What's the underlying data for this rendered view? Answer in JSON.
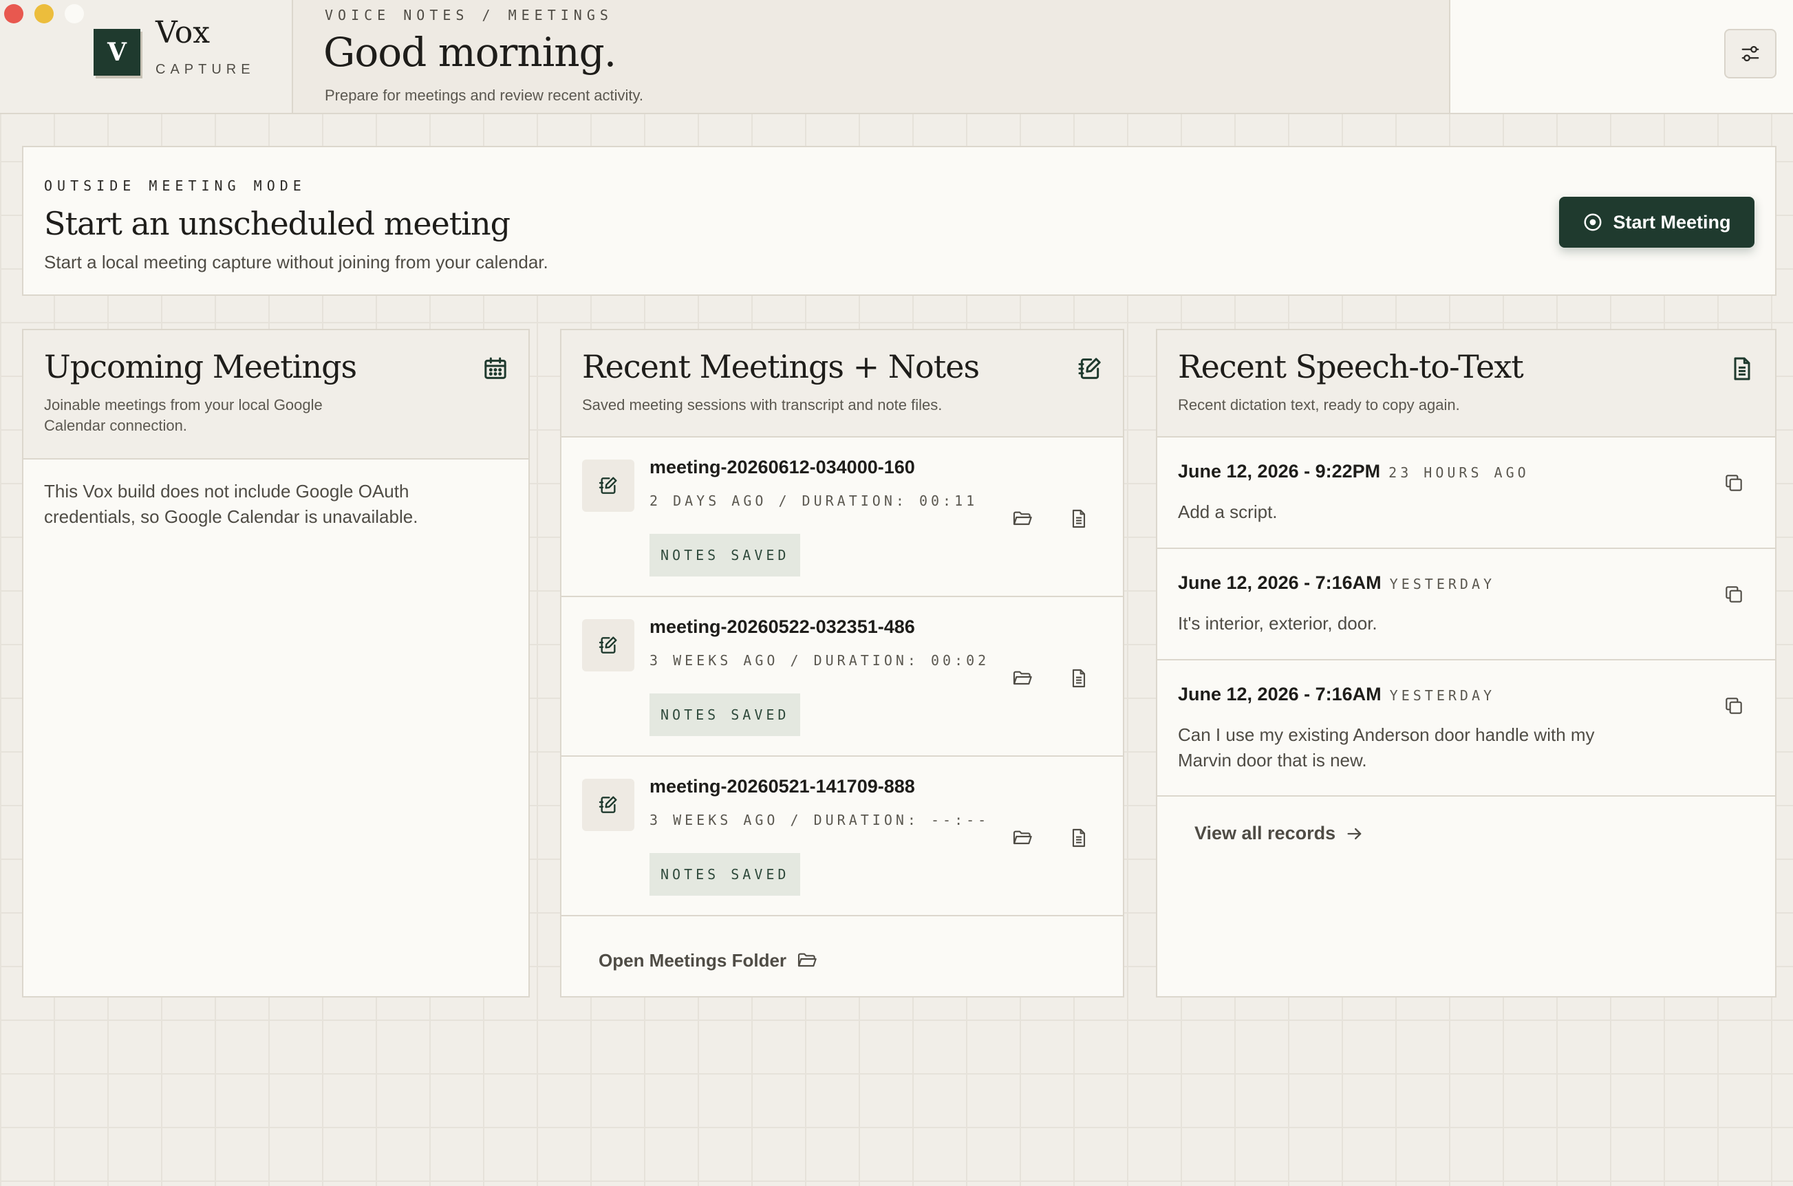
{
  "brand": {
    "logo_letter": "V",
    "name": "Vox",
    "subtitle": "CAPTURE"
  },
  "header": {
    "breadcrumb": "VOICE NOTES / MEETINGS",
    "greeting": "Good morning.",
    "subtitle": "Prepare for meetings and review recent activity."
  },
  "banner": {
    "kicker": "OUTSIDE MEETING MODE",
    "title": "Start an unscheduled meeting",
    "description": "Start a local meeting capture without joining from your calendar.",
    "button_label": "Start Meeting"
  },
  "upcoming": {
    "title": "Upcoming Meetings",
    "description": "Joinable meetings from your local Google Calendar connection.",
    "body": "This Vox build does not include Google OAuth credentials, so Google Calendar is unavailable."
  },
  "meetings": {
    "title": "Recent Meetings + Notes",
    "description": "Saved meeting sessions with transcript and note files.",
    "items": [
      {
        "name": "meeting-20260612-034000-160",
        "meta": "2 DAYS AGO / DURATION: 00:11",
        "badge": "NOTES SAVED"
      },
      {
        "name": "meeting-20260522-032351-486",
        "meta": "3 WEEKS AGO / DURATION: 00:02",
        "badge": "NOTES SAVED"
      },
      {
        "name": "meeting-20260521-141709-888",
        "meta": "3 WEEKS AGO / DURATION: --:--",
        "badge": "NOTES SAVED"
      }
    ],
    "open_folder_label": "Open Meetings Folder"
  },
  "stt": {
    "title": "Recent Speech-to-Text",
    "description": "Recent dictation text, ready to copy again.",
    "items": [
      {
        "date": "June 12, 2026 - 9:22PM",
        "relative": "23 HOURS AGO",
        "text": "Add a script."
      },
      {
        "date": "June 12, 2026 - 7:16AM",
        "relative": "YESTERDAY",
        "text": "It's interior, exterior, door."
      },
      {
        "date": "June 12, 2026 - 7:16AM",
        "relative": "YESTERDAY",
        "text": "Can I use my existing Anderson door handle with my Marvin door that is new."
      }
    ],
    "view_all_label": "View all records"
  },
  "colors": {
    "accent": "#1f3a2e",
    "background": "#f1eee8",
    "card": "#fbfaf6",
    "badge_bg": "#e4e8e0"
  }
}
